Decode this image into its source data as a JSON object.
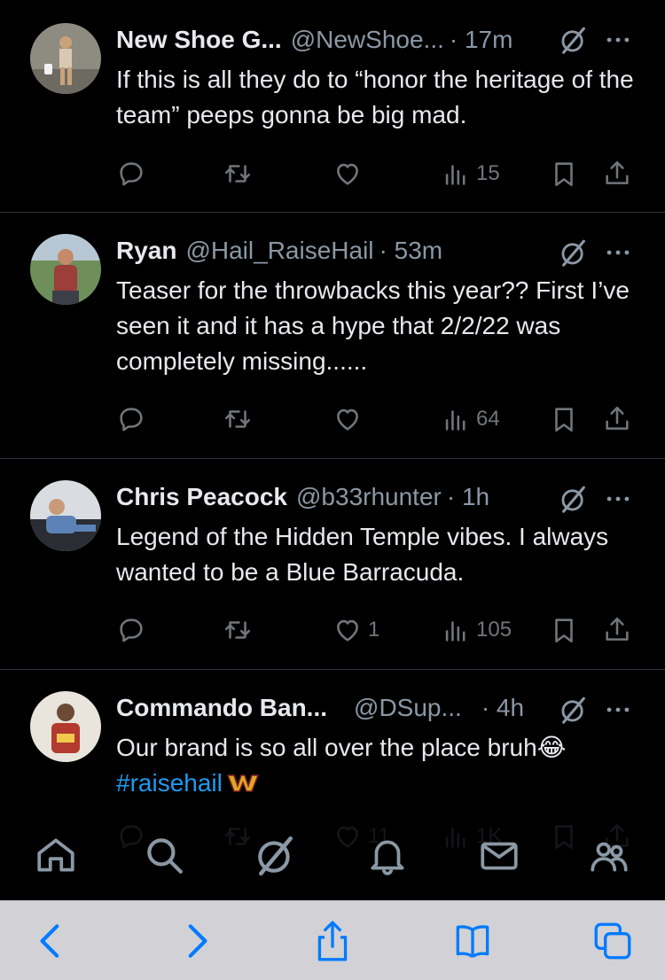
{
  "tweets": [
    {
      "name": "New Shoe G...",
      "handle": "@NewShoe...",
      "time": "· 17m",
      "text": "If this is all they do to “honor the heritage of the team” peeps gonna be big mad.",
      "replies": "",
      "retweets": "",
      "likes": "",
      "views": "15"
    },
    {
      "name": "Ryan",
      "handle": "@Hail_RaiseHail",
      "time": "· 53m",
      "text": "Teaser for the throwbacks this year?? First I’ve seen it and it has a hype that 2/2/22 was completely missing......",
      "replies": "",
      "retweets": "",
      "likes": "",
      "views": "64"
    },
    {
      "name": "Chris Peacock",
      "handle": "@b33rhunter",
      "time": "· 1h",
      "text": "Legend of the Hidden Temple vibes. I always wanted to be a Blue Barracuda.",
      "replies": "",
      "retweets": "",
      "likes": "1",
      "views": "105"
    },
    {
      "name": "Commando Ban...",
      "handle": "@DSup...",
      "time": "· 4h",
      "text": "Our brand is so all over the place bruh😂",
      "hashtag": "#raisehail",
      "replies": "",
      "retweets": "",
      "likes": "11",
      "views": "1K"
    }
  ],
  "nav": {
    "items": [
      "home-icon",
      "search-icon",
      "grok-icon",
      "notifications-icon",
      "messages-icon",
      "communities-icon"
    ]
  },
  "safari": {
    "items": [
      "back-icon",
      "forward-icon",
      "share-icon",
      "bookmarks-icon",
      "tabs-icon"
    ]
  },
  "colors": {
    "background": "#000000",
    "text": "#e7e9ea",
    "muted": "#71767b",
    "link": "#1d9bf0",
    "safari_bar": "#d1d1d6",
    "safari_icon": "#007aff"
  }
}
